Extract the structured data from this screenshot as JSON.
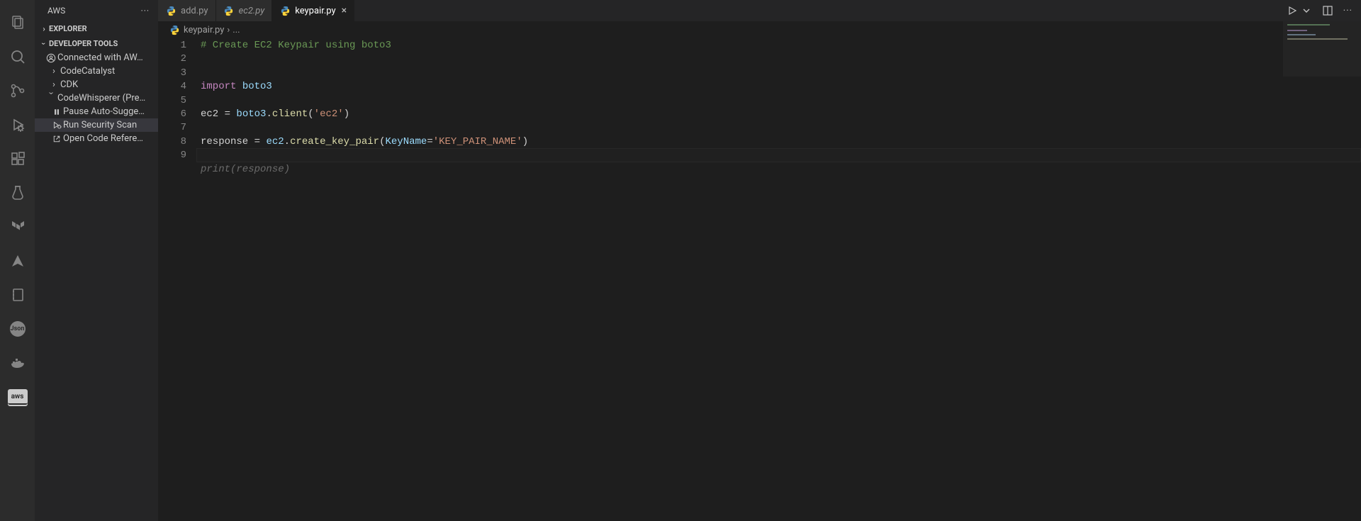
{
  "sidebar": {
    "title": "AWS",
    "explorer_label": "EXPLORER",
    "dev_tools_label": "DEVELOPER TOOLS",
    "items": {
      "connected": "Connected with AW…",
      "codecatalyst": "CodeCatalyst",
      "cdk": "CDK",
      "codewhisperer": "CodeWhisperer (Pre…",
      "pause": "Pause Auto-Sugge…",
      "runscan": "Run Security Scan",
      "opencode": "Open Code Refere…"
    }
  },
  "tabs": {
    "t0": {
      "label": "add.py"
    },
    "t1": {
      "label": "ec2.py"
    },
    "t2": {
      "label": "keypair.py"
    }
  },
  "breadcrumb": {
    "file": "keypair.py",
    "rest": "..."
  },
  "code": {
    "l1_comment": "# Create EC2 Keypair using boto3",
    "l4_kw": "import",
    "l4_mod": " boto3",
    "l6_a": "ec2 ",
    "l6_eq": "= ",
    "l6_b": "boto3",
    "l6_dot": ".",
    "l6_fn": "client",
    "l6_p1": "(",
    "l6_str": "'ec2'",
    "l6_p2": ")",
    "l8_a": "response ",
    "l8_eq": "= ",
    "l8_b": "ec2",
    "l8_dot": ".",
    "l8_fn": "create_key_pair",
    "l8_p1": "(",
    "l8_arg": "KeyName",
    "l8_eq2": "=",
    "l8_str": "'KEY_PAIR_NAME'",
    "l8_p2": ")",
    "suggest": "print(response)"
  },
  "line_numbers": [
    "1",
    "2",
    "3",
    "4",
    "5",
    "6",
    "7",
    "8",
    "9"
  ],
  "icons": {
    "aws_text": "aws",
    "json_text": "Json"
  }
}
